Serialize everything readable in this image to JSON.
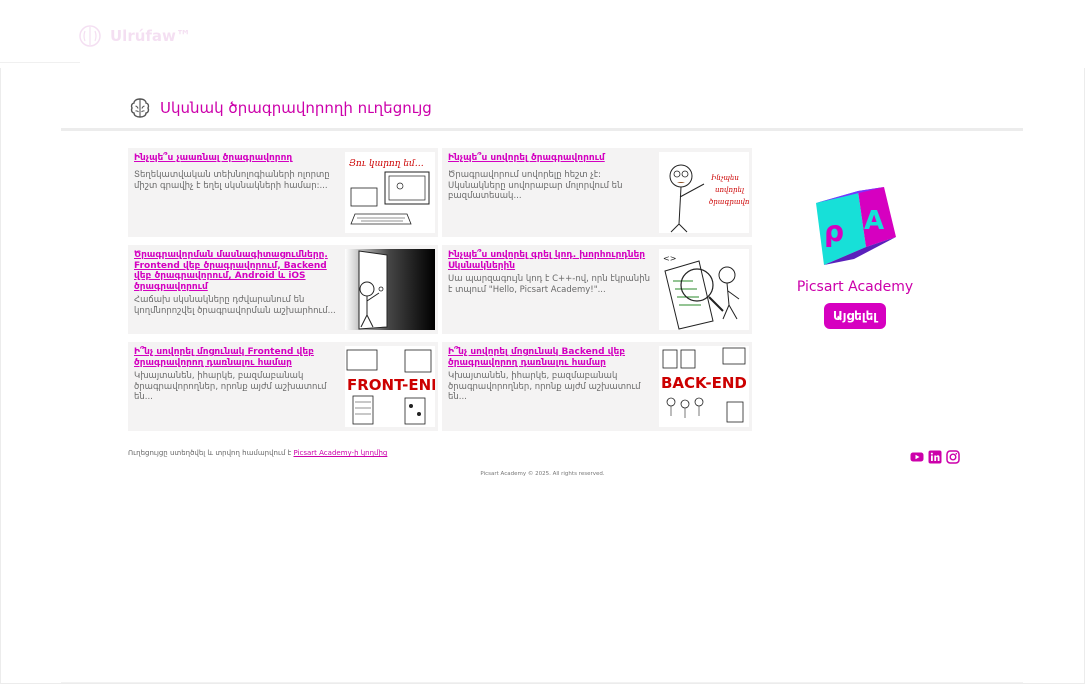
{
  "header": {
    "logo_text": "Ulrúfaw™",
    "page_title": "Սկսնակ ծրագրավորողի ուղեցույց"
  },
  "cards": [
    {
      "title": "Ինչպե՞ս չաառնալ ծրագրավորող",
      "description": "Տեղեկատվական տեխնոլոգիաների ոլորտը միշտ գրավիչ է եղել սկսնակների համար:..."
    },
    {
      "title": "Ինչպե՞ս սովորել ծրագրավորում",
      "description": "Ծրագրավորում սովորելը hեշտ չէ: Սկսնակները սովորաբար մոլորվում են բազմատեսակ..."
    },
    {
      "title": "Ծրագրավորման մասնագիտացումները. Frontend վեբ ծրագրավորում, Backend վեբ ծրագրավորում, Android և iOS ծրագրավորում",
      "description": "Հաճախ սկսնակները դժվարանում են կողմնորոշվել ծրագրավորման աշխարհում..."
    },
    {
      "title": "Ինչպե՞ս սովորել գրել կոդ. խորհուրդներ Սկսնակներին",
      "description": "Սա պարզագույն կոդ է C++-ով, որն էկրանին է տպում \"Hello, Picsart Academy!\"..."
    },
    {
      "title": "Ի՞նչ սովորել մոցունակ Frontend վեբ ծրագրավորող դառնալու համար",
      "description": "Կխայտանեն, իհարկե, բազմաբանակ ծրագրավորողներ, որոնք այժմ աշխատում են..."
    },
    {
      "title": "Ի՞նչ սովորել մոցունակ Backend վեբ ծրագրավորող դառնալու համար",
      "description": "Կխայտանեն, իհարկե, բազմաբանակ ծրագրավորողներ, որոնք այժմ աշխատում են..."
    }
  ],
  "promo": {
    "name": "Picsart Academy",
    "button_label": "Այցելել"
  },
  "footer": {
    "note": "Ուղեցույցը ստեղծվել և տրվող համարվում է",
    "link": "Picsart Academy-ի կողմից",
    "copyright": "Picsart Academy © 2025. All rights reserved."
  },
  "social_icons": [
    "youtube-icon",
    "linkedin-icon",
    "instagram-icon"
  ],
  "colors": {
    "accent": "#d600c0",
    "card_bg": "#f4f3f3",
    "divider": "#ececec"
  }
}
